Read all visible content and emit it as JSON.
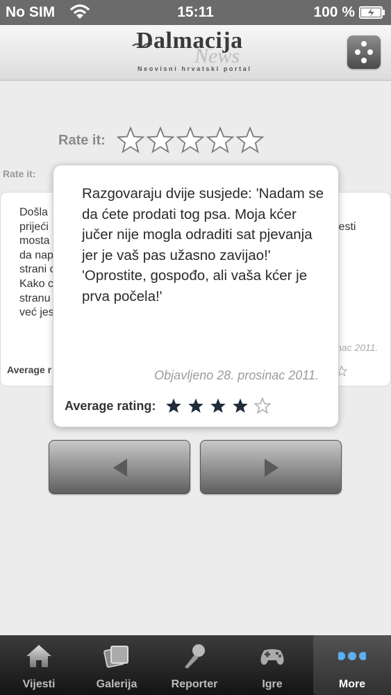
{
  "status_bar": {
    "carrier": "No SIM",
    "time": "15:11",
    "battery": "100 %"
  },
  "header": {
    "logo_line1": "Dalmacija",
    "logo_line2": "News",
    "logo_tagline": "Neovisni hrvatski portal"
  },
  "rate": {
    "label": "Rate it:",
    "small_label": "Rate it:"
  },
  "background_card": {
    "text_lines": [
      "Došla",
      "prijeći",
      "mosta",
      "da nap",
      "strani c",
      "Kako c",
      "stranu",
      "već jes"
    ],
    "text_right": "jesti",
    "date_partial": "nac 2011.",
    "avg_label": "Average r"
  },
  "popup": {
    "joke": "Razgovaraju dvije susjede: 'Nadam se da ćete prodati tog psa. Moja kćer jučer nije mogla odraditi sat pjevanja jer je vaš pas užasno zavijao!' 'Oprostite, gospođo, ali vaša kćer je prva počela!'",
    "date": "Objavljeno 28. prosinac 2011.",
    "avg_label": "Average rating:",
    "rating": 4,
    "rating_max": 5
  },
  "tabs": [
    {
      "label": "Vijesti",
      "icon": "home-icon"
    },
    {
      "label": "Galerija",
      "icon": "gallery-icon"
    },
    {
      "label": "Reporter",
      "icon": "microphone-icon"
    },
    {
      "label": "Igre",
      "icon": "gamepad-icon"
    },
    {
      "label": "More",
      "icon": "more-icon"
    }
  ],
  "colors": {
    "status_bar": "#6b6b6b",
    "tabbar": "#1c1c1c",
    "star_filled": "#1f2c3a"
  }
}
